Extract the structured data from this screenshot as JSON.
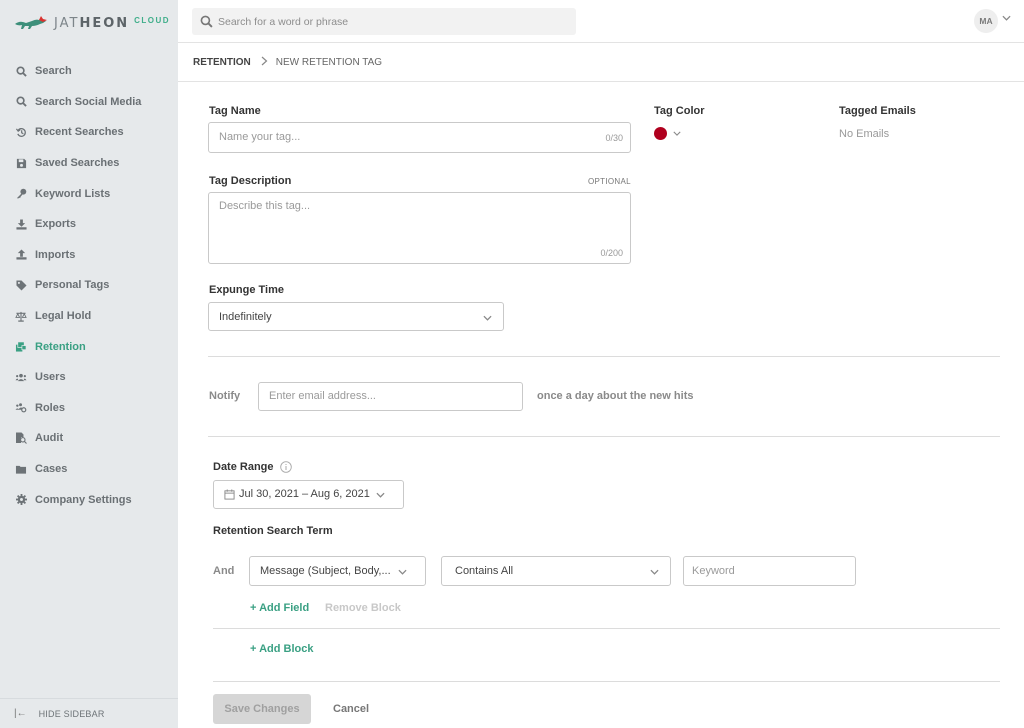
{
  "brand": {
    "name_light": "JAT",
    "name_bold": "HEON",
    "suffix": "CLOUD",
    "accent_color": "#3aa083"
  },
  "sidebar": {
    "items": [
      {
        "label": "Search",
        "icon": "search-icon",
        "active": false
      },
      {
        "label": "Search Social Media",
        "icon": "search-icon",
        "active": false
      },
      {
        "label": "Recent Searches",
        "icon": "history-icon",
        "active": false
      },
      {
        "label": "Saved Searches",
        "icon": "floppy-disk-icon",
        "active": false
      },
      {
        "label": "Keyword Lists",
        "icon": "key-icon",
        "active": false
      },
      {
        "label": "Exports",
        "icon": "download-icon",
        "active": false
      },
      {
        "label": "Imports",
        "icon": "upload-icon",
        "active": false
      },
      {
        "label": "Personal Tags",
        "icon": "tag-icon",
        "active": false
      },
      {
        "label": "Legal Hold",
        "icon": "scale-icon",
        "active": false
      },
      {
        "label": "Retention",
        "icon": "retention-icon",
        "active": true
      },
      {
        "label": "Users",
        "icon": "users-icon",
        "active": false
      },
      {
        "label": "Roles",
        "icon": "roles-icon",
        "active": false
      },
      {
        "label": "Audit",
        "icon": "audit-icon",
        "active": false
      },
      {
        "label": "Cases",
        "icon": "folder-icon",
        "active": false
      },
      {
        "label": "Company Settings",
        "icon": "gear-icon",
        "active": false
      }
    ],
    "hide_label": "HIDE SIDEBAR"
  },
  "topbar": {
    "search_placeholder": "Search for a word or phrase",
    "avatar_initials": "MA"
  },
  "breadcrumb": {
    "root": "RETENTION",
    "current": "NEW RETENTION TAG"
  },
  "form": {
    "tag_name": {
      "label": "Tag Name",
      "placeholder": "Name your tag...",
      "value": "",
      "counter": "0/30"
    },
    "tag_color": {
      "label": "Tag Color",
      "value": "#b0001e"
    },
    "tagged_emails": {
      "label": "Tagged Emails",
      "value": "No Emails"
    },
    "tag_description": {
      "label": "Tag Description",
      "optional_label": "OPTIONAL",
      "placeholder": "Describe this tag...",
      "value": "",
      "counter": "0/200"
    },
    "expunge_time": {
      "label": "Expunge Time",
      "selected": "Indefinitely"
    },
    "notify": {
      "label": "Notify",
      "placeholder": "Enter email address...",
      "value": "",
      "suffix": "once a day about the new hits"
    },
    "date_range": {
      "label": "Date Range",
      "value": "Jul 30, 2021 – Aug 6, 2021"
    },
    "retention_search_term": {
      "label": "Retention Search Term",
      "rows": [
        {
          "operator": "And",
          "field": "Message (Subject, Body,...",
          "condition": "Contains All",
          "keyword_placeholder": "Keyword",
          "keyword_value": ""
        }
      ],
      "add_field_label": "+ Add Field",
      "remove_block_label": "Remove Block",
      "add_block_label": "+ Add Block"
    }
  },
  "actions": {
    "save_label": "Save Changes",
    "cancel_label": "Cancel"
  }
}
